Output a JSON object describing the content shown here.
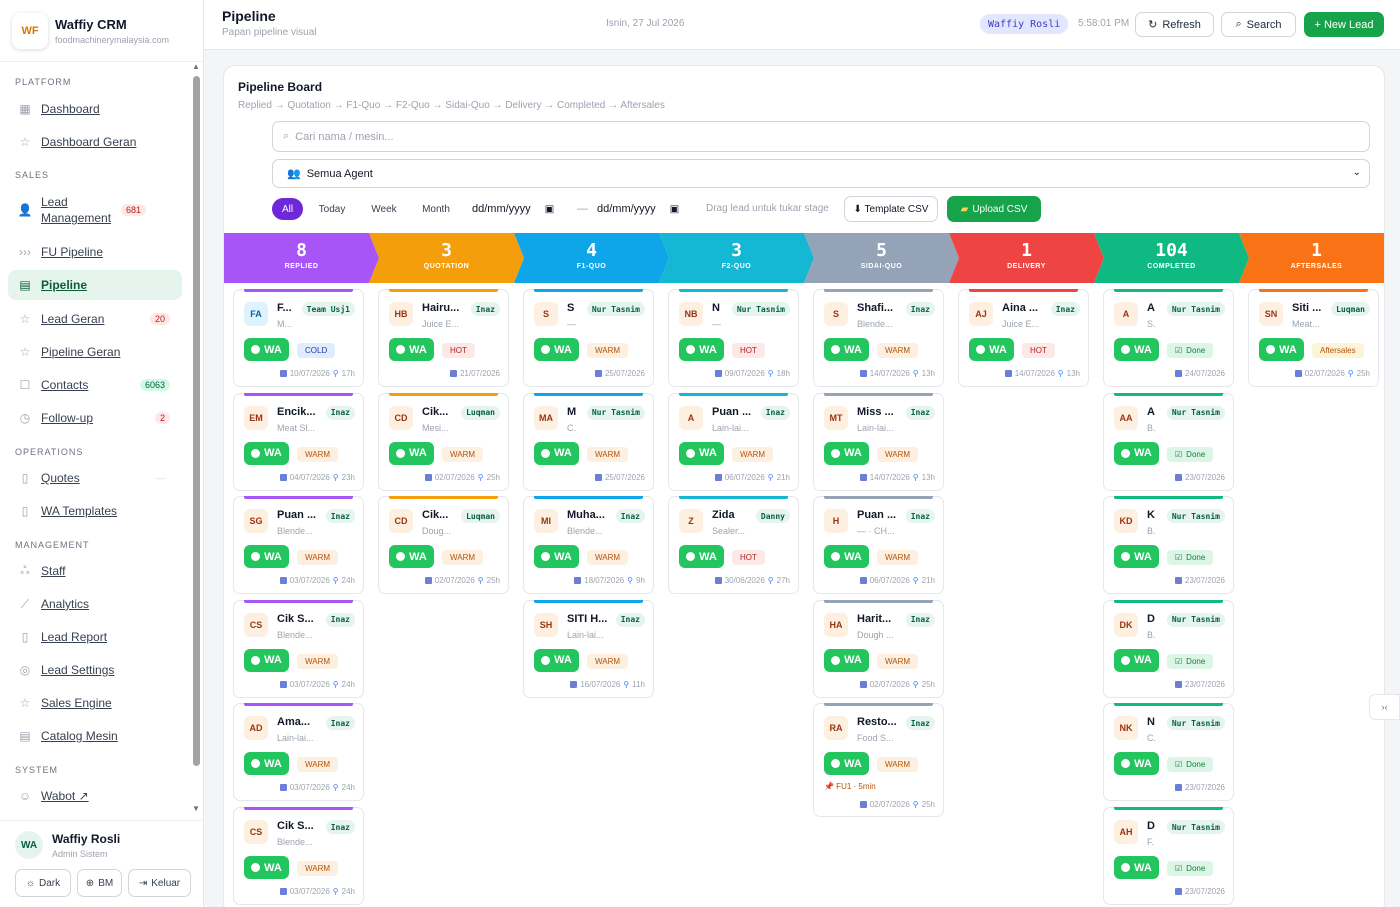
{
  "brand": {
    "name": "Waffiy CRM",
    "sub": "foodmachinerymalaysia.com",
    "logo": "WF"
  },
  "nav": {
    "sections": {
      "platform": "PLATFORM",
      "sales": "SALES",
      "operations": "OPERATIONS",
      "management": "MANAGEMENT",
      "system": "SYSTEM"
    },
    "items": [
      {
        "label": "Dashboard",
        "icon": "grid-icon"
      },
      {
        "label": "Dashboard Geran",
        "icon": "star-icon"
      },
      {
        "label": "Lead Management",
        "icon": "person-icon",
        "count": "681"
      },
      {
        "label": "FU Pipeline",
        "icon": "dots-arrow-icon"
      },
      {
        "label": "Pipeline",
        "icon": "table-icon"
      },
      {
        "label": "Lead Geran",
        "icon": "star-icon",
        "count": "20"
      },
      {
        "label": "Pipeline Geran",
        "icon": "star-icon"
      },
      {
        "label": "Contacts",
        "icon": "contact-icon",
        "count": "6063"
      },
      {
        "label": "Follow-up",
        "icon": "clock-icon",
        "count": "2"
      },
      {
        "label": "Quotes",
        "icon": "document-icon",
        "count": "—"
      },
      {
        "label": "WA Templates",
        "icon": "document-icon"
      },
      {
        "label": "Staff",
        "icon": "people-icon"
      },
      {
        "label": "Analytics",
        "icon": "trend-icon"
      },
      {
        "label": "Lead Report",
        "icon": "document-icon"
      },
      {
        "label": "Lead Settings",
        "icon": "target-icon"
      },
      {
        "label": "Sales Engine",
        "icon": "star-icon"
      },
      {
        "label": "Catalog Mesin",
        "icon": "table-icon"
      },
      {
        "label": "Wabot ↗",
        "icon": "smile-icon"
      }
    ]
  },
  "profile": {
    "initials": "WA",
    "name": "Waffiy Rosli",
    "role": "Admin Sistem",
    "dark": "Dark",
    "lang": "BM",
    "logout": "Keluar"
  },
  "header": {
    "title": "Pipeline",
    "subtitle": "Papan pipeline visual",
    "date": "Isnin, 27 Jul 2026",
    "user": "Waffiy Rosli",
    "time": "5:58:01 PM",
    "refresh": "Refresh",
    "search": "Search",
    "new_lead": "+ New Lead"
  },
  "board": {
    "title": "Pipeline Board",
    "flow": "Replied → Quotation → F1-Quo → F2-Quo → Sidai-Quo → Delivery → Completed → Aftersales",
    "search_placeholder": "Cari nama / mesin...",
    "agent_filter": "Semua Agent",
    "filters": [
      "All",
      "Today",
      "Week",
      "Month"
    ],
    "date_placeholder": "dd/mm/yyyy",
    "date_sep": "—",
    "hint": "Drag lead untuk tukar stage",
    "template_btn": "⬇ Template CSV",
    "upload_btn": "Upload CSV"
  },
  "stages": [
    {
      "count": "8",
      "label": "REPLIED",
      "color": "#a855f7"
    },
    {
      "count": "3",
      "label": "QUOTATION",
      "color": "#f59e0b"
    },
    {
      "count": "4",
      "label": "F1-QUO",
      "color": "#0ea5e9"
    },
    {
      "count": "3",
      "label": "F2-QUO",
      "color": "#14b8d4"
    },
    {
      "count": "5",
      "label": "SIDAI-QUO",
      "color": "#94a3b8"
    },
    {
      "count": "1",
      "label": "DELIVERY",
      "color": "#ef4444"
    },
    {
      "count": "104",
      "label": "COMPLETED",
      "color": "#10b981"
    },
    {
      "count": "1",
      "label": "AFTERSALES",
      "color": "#f97316"
    }
  ],
  "columns": [
    {
      "cards": [
        {
          "ini": "FA",
          "name": "F...",
          "agent": "Team Usj1",
          "sub": "M...",
          "temp": "COLD",
          "date": "10/07/2026",
          "age": "17h"
        },
        {
          "ini": "EM",
          "name": "Encik...",
          "agent": "Inaz",
          "sub": "Meat Sl...",
          "temp": "WARM",
          "date": "04/07/2026",
          "age": "23h"
        },
        {
          "ini": "SG",
          "name": "Puan ...",
          "agent": "Inaz",
          "sub": "Blende...",
          "temp": "WARM",
          "date": "03/07/2026",
          "age": "24h"
        },
        {
          "ini": "CS",
          "name": "Cik S...",
          "agent": "Inaz",
          "sub": "Blende...",
          "temp": "WARM",
          "date": "03/07/2026",
          "age": "24h"
        },
        {
          "ini": "AD",
          "name": "Ama...",
          "agent": "Inaz",
          "sub": "Lain-lai...",
          "temp": "WARM",
          "date": "03/07/2026",
          "age": "24h"
        },
        {
          "ini": "CS",
          "name": "Cik S...",
          "agent": "Inaz",
          "sub": "Blende...",
          "temp": "WARM",
          "date": "03/07/2026",
          "age": "24h"
        }
      ]
    },
    {
      "cards": [
        {
          "ini": "HB",
          "name": "Hairu...",
          "agent": "Inaz",
          "sub": "Juice E...",
          "temp": "HOT",
          "date": "21/07/2026",
          "age": ""
        },
        {
          "ini": "CD",
          "name": "Cik...",
          "agent": "Luqman",
          "sub": "Mesi...",
          "temp": "WARM",
          "date": "02/07/2026",
          "age": "25h"
        },
        {
          "ini": "CD",
          "name": "Cik...",
          "agent": "Luqman",
          "sub": "Doug...",
          "temp": "WARM",
          "date": "02/07/2026",
          "age": "25h"
        }
      ]
    },
    {
      "cards": [
        {
          "ini": "S",
          "name": "S",
          "agent": "Nur Tasnim",
          "sub": "—",
          "temp": "WARM",
          "date": "25/07/2026",
          "age": ""
        },
        {
          "ini": "MA",
          "name": "M",
          "agent": "Nur Tasnim",
          "sub": "C.",
          "temp": "WARM",
          "date": "25/07/2026",
          "age": ""
        },
        {
          "ini": "MI",
          "name": "Muha...",
          "agent": "Inaz",
          "sub": "Blende...",
          "temp": "WARM",
          "date": "18/07/2026",
          "age": "9h"
        },
        {
          "ini": "SH",
          "name": "SITI H...",
          "agent": "Inaz",
          "sub": "Lain-lai...",
          "temp": "WARM",
          "date": "16/07/2026",
          "age": "11h"
        }
      ]
    },
    {
      "cards": [
        {
          "ini": "NB",
          "name": "N",
          "agent": "Nur Tasnim",
          "sub": "—",
          "temp": "HOT",
          "date": "09/07/2026",
          "age": "18h"
        },
        {
          "ini": "A",
          "name": "Puan ...",
          "agent": "Inaz",
          "sub": "Lain-lai...",
          "temp": "WARM",
          "date": "06/07/2026",
          "age": "21h"
        },
        {
          "ini": "Z",
          "name": "Zida",
          "agent": "Danny",
          "sub": "Sealer...",
          "temp": "HOT",
          "date": "30/06/2026",
          "age": "27h"
        }
      ]
    },
    {
      "cards": [
        {
          "ini": "S",
          "name": "Shafi...",
          "agent": "Inaz",
          "sub": "Blende...",
          "temp": "WARM",
          "date": "14/07/2026",
          "age": "13h"
        },
        {
          "ini": "MT",
          "name": "Miss ...",
          "agent": "Inaz",
          "sub": "Lain-lai...",
          "temp": "WARM",
          "date": "14/07/2026",
          "age": "13h"
        },
        {
          "ini": "H",
          "name": "Puan ...",
          "agent": "Inaz",
          "sub": "— · CH...",
          "temp": "WARM",
          "date": "06/07/2026",
          "age": "21h"
        },
        {
          "ini": "HA",
          "name": "Harit...",
          "agent": "Inaz",
          "sub": "Dough ...",
          "temp": "WARM",
          "date": "02/07/2026",
          "age": "25h"
        },
        {
          "ini": "RA",
          "name": "Resto...",
          "agent": "Inaz",
          "sub": "Food S...",
          "temp": "WARM",
          "date": "02/07/2026",
          "age": "25h",
          "note": "📌 FU1 · 5min"
        }
      ]
    },
    {
      "cards": [
        {
          "ini": "AJ",
          "name": "Aina ...",
          "agent": "Inaz",
          "sub": "Juice E...",
          "temp": "HOT",
          "date": "14/07/2026",
          "age": "13h"
        }
      ]
    },
    {
      "cards": [
        {
          "ini": "A",
          "name": "A",
          "agent": "Nur Tasnim",
          "sub": "S.",
          "temp": "Done",
          "date": "24/07/2026",
          "age": ""
        },
        {
          "ini": "AA",
          "name": "A",
          "agent": "Nur Tasnim",
          "sub": "B.",
          "temp": "Done",
          "date": "23/07/2026",
          "age": ""
        },
        {
          "ini": "KD",
          "name": "K",
          "agent": "Nur Tasnim",
          "sub": "B.",
          "temp": "Done",
          "date": "23/07/2026",
          "age": ""
        },
        {
          "ini": "DK",
          "name": "D",
          "agent": "Nur Tasnim",
          "sub": "B.",
          "temp": "Done",
          "date": "23/07/2026",
          "age": ""
        },
        {
          "ini": "NK",
          "name": "N",
          "agent": "Nur Tasnim",
          "sub": "C.",
          "temp": "Done",
          "date": "23/07/2026",
          "age": ""
        },
        {
          "ini": "AH",
          "name": "D",
          "agent": "Nur Tasnim",
          "sub": "F.",
          "temp": "Done",
          "date": "23/07/2026",
          "age": ""
        }
      ]
    },
    {
      "cards": [
        {
          "ini": "SN",
          "name": "Siti ...",
          "agent": "Luqman",
          "sub": "Meat...",
          "temp": "Aftersales",
          "date": "02/07/2026",
          "age": "25h"
        }
      ]
    }
  ],
  "wa_label": "WA",
  "fab": "›‹"
}
